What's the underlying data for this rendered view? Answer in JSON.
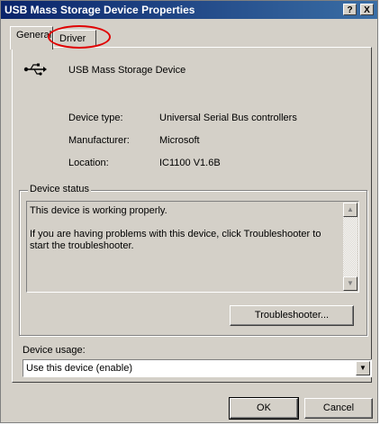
{
  "window": {
    "title": "USB Mass Storage Device Properties",
    "help_button": "?",
    "close_button": "X"
  },
  "tabs": [
    {
      "label": "General",
      "active": true
    },
    {
      "label": "Driver",
      "active": false
    }
  ],
  "device": {
    "name": "USB Mass Storage Device",
    "icon": "usb-icon",
    "properties": [
      {
        "label": "Device type:",
        "value": "Universal Serial Bus controllers"
      },
      {
        "label": "Manufacturer:",
        "value": "Microsoft"
      },
      {
        "label": "Location:",
        "value": "IC1100 V1.6B"
      }
    ]
  },
  "device_status": {
    "legend": "Device status",
    "line1": "This device is working properly.",
    "line2": "If you are having problems with this device, click Troubleshooter to start the troubleshooter.",
    "troubleshooter_button": "Troubleshooter..."
  },
  "device_usage": {
    "label": "Device usage:",
    "selected": "Use this device (enable)"
  },
  "footer": {
    "ok_label": "OK",
    "cancel_label": "Cancel"
  },
  "colors": {
    "title_bar": "#0a246a",
    "dialog_face": "#d4d0c8",
    "highlight_circle": "#e00000"
  }
}
